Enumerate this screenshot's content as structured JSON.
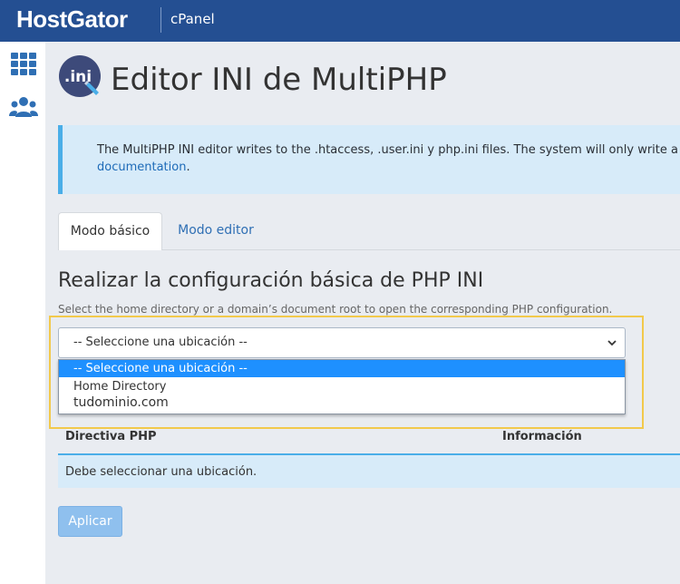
{
  "header": {
    "brand": "HostGator",
    "product": "cPanel"
  },
  "sidebar": {
    "icons": [
      "grid-icon",
      "users-icon"
    ]
  },
  "page": {
    "title_icon_text": ".ini",
    "title": "Editor INI de MultiPHP"
  },
  "info": {
    "text": "The MultiPHP INI editor writes to the .htaccess, .user.ini y php.ini files. The system will only write a d",
    "link": "documentation",
    "after_link": "."
  },
  "tabs": [
    {
      "label": "Modo básico",
      "active": true
    },
    {
      "label": "Modo editor",
      "active": false
    }
  ],
  "section": {
    "title": "Realizar la configuración básica de PHP INI",
    "subtitle": "Select the home directory or a domain’s document root to open the corresponding PHP configuration."
  },
  "location_select": {
    "value": "-- Seleccione una ubicación --",
    "options": [
      "-- Seleccione una ubicación --",
      "Home Directory",
      "tudominio.com"
    ]
  },
  "table": {
    "headers": [
      "Directiva PHP",
      "Información"
    ],
    "message": "Debe seleccionar una ubicación."
  },
  "actions": {
    "apply_label": "Aplicar"
  },
  "colors": {
    "topbar": "#244f92",
    "info_bg": "#d7ebf9",
    "info_border": "#4aaee8",
    "link": "#1e6bb8",
    "highlight": "#f2c94c",
    "selected_option": "#1e90ff",
    "apply_button": "#8fc0ee"
  }
}
